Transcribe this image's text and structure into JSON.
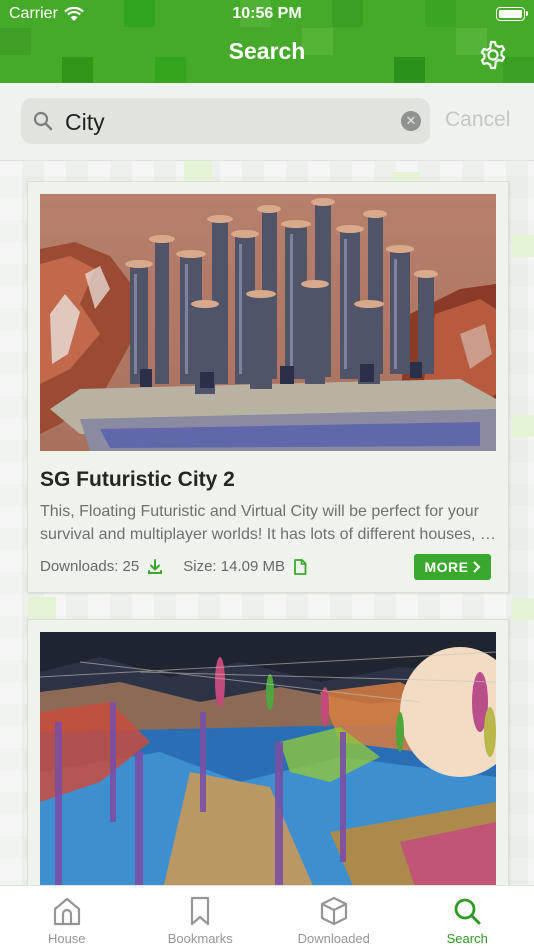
{
  "status_bar": {
    "carrier": "Carrier",
    "time": "10:56 PM"
  },
  "nav": {
    "title": "Search",
    "settings_icon": "gear-icon"
  },
  "search": {
    "value": "City",
    "cancel_label": "Cancel",
    "search_icon": "magnifier-icon",
    "clear_icon": "clear-circle-icon"
  },
  "results": [
    {
      "title": "SG Futuristic City 2",
      "description_line1": "This, Floating Futuristic and Virtual City will be perfect for your",
      "description_line2": "survival and multiplayer worlds! It has lots of different houses, a...",
      "downloads": "Downloads: 25",
      "size": "Size: 14.09 MB",
      "more_label": "MORE"
    }
  ],
  "tabs": [
    {
      "label": "House",
      "icon": "house-icon",
      "active": false
    },
    {
      "label": "Bookmarks",
      "icon": "bookmark-icon",
      "active": false
    },
    {
      "label": "Downloaded",
      "icon": "box-icon",
      "active": false
    },
    {
      "label": "Search",
      "icon": "search-icon",
      "active": true
    }
  ],
  "colors": {
    "brand_green": "#45a92a",
    "button_green": "#3aa82d",
    "active_tab": "#2f9a22"
  }
}
